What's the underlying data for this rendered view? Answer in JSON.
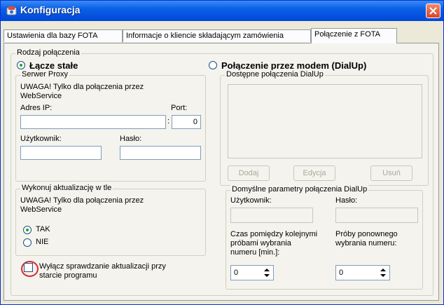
{
  "window": {
    "title": "Konfiguracja"
  },
  "tabs": [
    {
      "label": "Ustawienia dla bazy FOTA"
    },
    {
      "label": "Informacje o kliencie składającym zamówienia"
    },
    {
      "label": "Połączenie z FOTA"
    }
  ],
  "connection_type": {
    "legend": "Rodzaj połączenia",
    "fixed_label": "Łącze stałe",
    "fixed_selected": true,
    "dialup_label": "Połączenie przez modem (DialUp)",
    "dialup_selected": false
  },
  "proxy": {
    "legend": "Serwer Proxy",
    "warning": "UWAGA! Tylko dla połączenia przez WebService",
    "ip_label": "Adres IP:",
    "ip_value": "",
    "port_label": "Port:",
    "port_separator": ":",
    "port_value": "0",
    "user_label": "Użytkownik:",
    "user_value": "",
    "pass_label": "Hasło:",
    "pass_value": ""
  },
  "background_update": {
    "legend": "Wykonuj aktualizację w tle",
    "warning": "UWAGA! Tylko dla połączenia przez WebService",
    "yes_label": "TAK",
    "yes_selected": true,
    "no_label": "NIE",
    "no_selected": false
  },
  "startup_check": {
    "label_line1": "Wyłącz sprawdzanie aktualizacji przy",
    "label_line2": "starcie programu",
    "checked": false
  },
  "dialup": {
    "legend": "Dostępne połączenia DialUp",
    "add_label": "Dodaj",
    "edit_label": "Edycja",
    "delete_label": "Usuń"
  },
  "dialup_defaults": {
    "legend": "Domyślne parametry połączenia DialUp",
    "user_label": "Użytkownik:",
    "pass_label": "Hasło:",
    "interval_label_1": "Czas pomiędzy kolejnymi",
    "interval_label_2": "próbami wybrania",
    "interval_label_3": "numeru [min.]:",
    "interval_value": "0",
    "retries_label_1": "Próby ponownego",
    "retries_label_2": "wybrania numeru:",
    "retries_value": "0"
  },
  "colors": {
    "titlebar": "#0a5fe6",
    "highlight": "#e0262c",
    "radio_dot": "#21a121"
  }
}
